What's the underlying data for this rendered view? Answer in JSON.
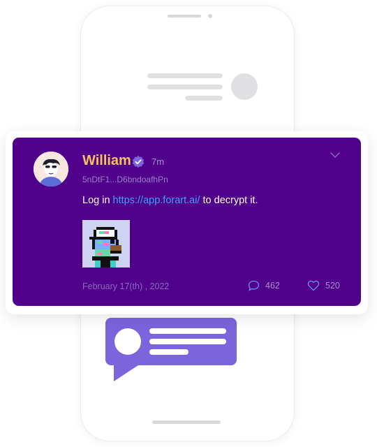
{
  "post": {
    "author_name": "William",
    "verified": true,
    "time_ago": "7m",
    "handle": "5nDtF1...D6bndoafhPn",
    "message_prefix": "Log in ",
    "message_link": "https://app.forart.ai/",
    "message_suffix": " to decrypt it.",
    "date": "February 17(th) , 2022",
    "comments_count": "462",
    "likes_count": "520"
  },
  "colors": {
    "card_bg": "#50008a",
    "author_name": "#f5c35b",
    "link": "#3aa5ff",
    "bubble": "#7b64dc",
    "verified_badge": "#7b64dc"
  },
  "icons": {
    "verified": "verified-badge-icon",
    "menu": "chevron-down-icon",
    "comments": "comment-bubble-icon",
    "likes": "heart-icon"
  }
}
